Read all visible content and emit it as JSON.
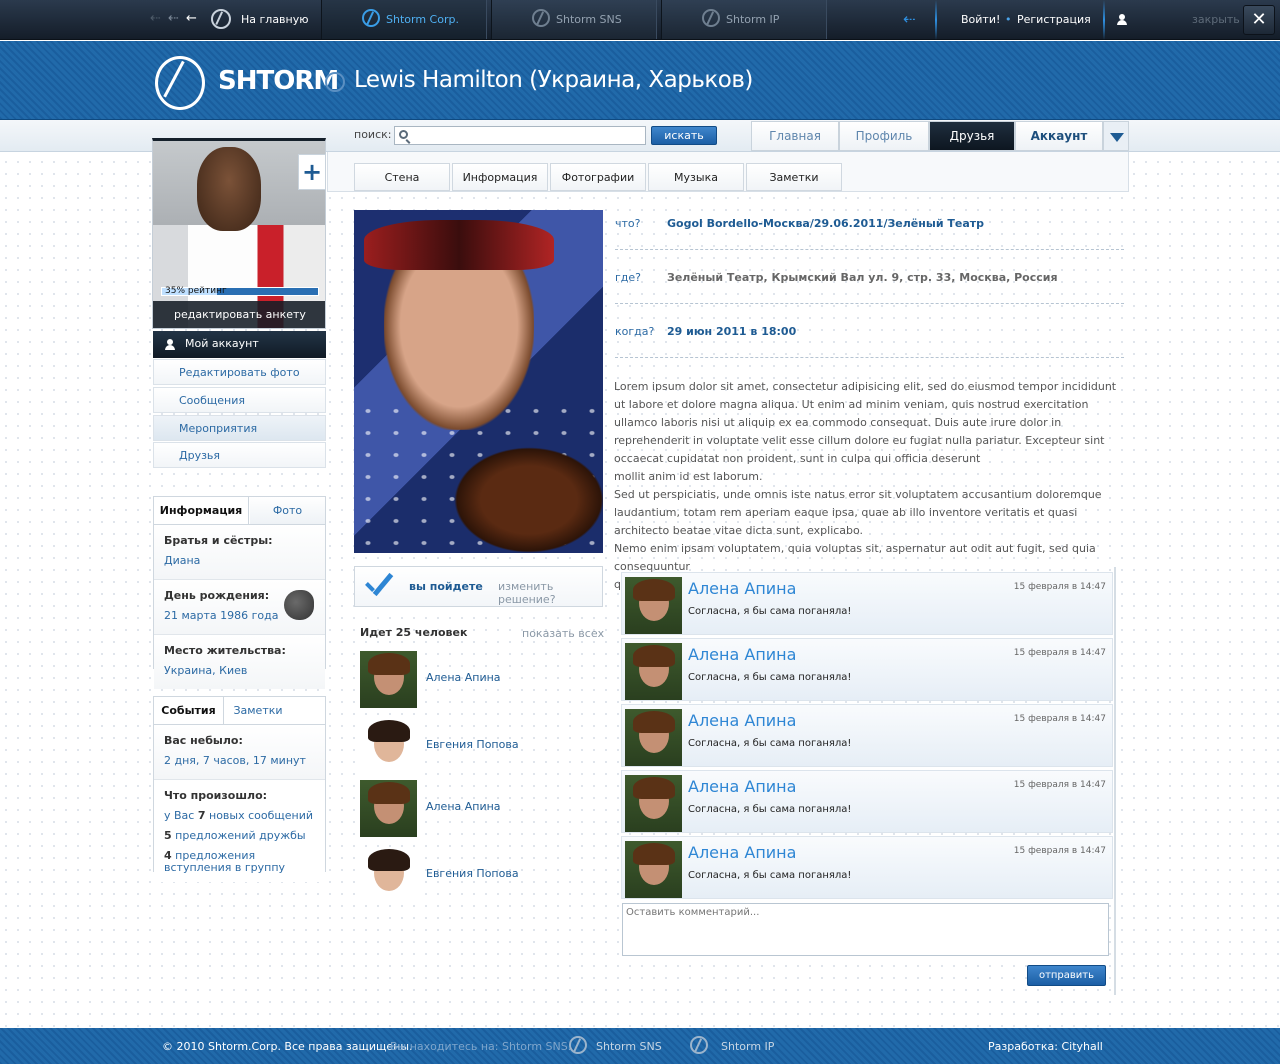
{
  "topbar": {
    "home": "На главную",
    "tabs": [
      "Shtorm Corp.",
      "Shtorm SNS",
      "Shtorm IP"
    ],
    "login": "Войти!",
    "register": "Регистрация",
    "close": "закрыть -"
  },
  "header": {
    "brand": "SHTORM",
    "title": "Lewis Hamilton (Украина, Харьков)"
  },
  "search": {
    "label": "поиск:",
    "placeholder": "",
    "button": "искать"
  },
  "main_tabs": [
    "Главная",
    "Профиль",
    "Друзья",
    "Аккаунт"
  ],
  "sub_tabs": [
    "Стена",
    "Информация",
    "Фотографии",
    "Музыка",
    "Заметки"
  ],
  "profile": {
    "rating": "35% рейтинг",
    "rating_value": 0.35,
    "edit": "редактировать анкету"
  },
  "side_nav": {
    "my_account": "Мой аккаунт",
    "items": [
      "Редактировать фото",
      "Сообщения",
      "Мероприятия",
      "Друзья"
    ]
  },
  "info_box": {
    "tabs": [
      "Информация",
      "Фото"
    ],
    "siblings_label": "Братья и сёстры:",
    "siblings_value": "Диана",
    "birthday_label": "День рождения:",
    "birthday_value": "21 марта 1986 года",
    "residence_label": "Место жительства:",
    "residence_value": "Украина, Киев"
  },
  "events_box": {
    "tabs": [
      "События",
      "Заметки"
    ],
    "absent_label": "Вас небыло:",
    "absent_value": "2 дня, 7 часов, 17 минут",
    "happened_label": "Что произошло:",
    "l1_pre": "у Вас ",
    "l1_num": "7",
    "l1_post": " новых сообщений",
    "l2_num": "5",
    "l2_post": " предложений дружбы",
    "l3_num": "4",
    "l3_post": " предложения вступления в группу"
  },
  "event": {
    "what_label": "что?",
    "what": "Gogol Bordello-Москва/29.06.2011/Зелёный Театр",
    "where_label": "где?",
    "where": "Зелёный Театр, Крымский Вал ул. 9, стр. 33, Москва, Россия",
    "when_label": "когда?",
    "when": "29 июн 2011 в 18:00",
    "description": "Lorem ipsum dolor sit amet, consectetur adipisicing elit, sed do eiusmod tempor incididunt ut labore et dolore magna aliqua. Ut enim ad minim veniam, quis nostrud exercitation ullamco laboris nisi ut aliquip ex ea commodo consequat. Duis aute irure dolor in reprehenderit in voluptate velit esse cillum dolore eu fugiat nulla pariatur. Excepteur sint occaecat cupidatat non proident, sunt in culpa qui officia deserunt\n mollit anim id est laborum.\nSed ut perspiciatis, unde omnis iste natus error sit voluptatem accusantium doloremque laudantium, totam rem aperiam eaque ipsa, quae ab illo inventore veritatis et quasi architecto beatae vitae dicta sunt, explicabo.\nNemo enim ipsam voluptatem, quia voluptas sit, aspernatur aut odit aut fugit, sed quia consequuntur\n qui dolorem ipsum, quia dolor sit, amet, consectetur, adipisci velit, sed quia non"
  },
  "going": {
    "status": "вы пойдете",
    "change": "изменить решение?",
    "title": "Идет 25 человек",
    "show_all": "показать всех",
    "people": [
      "Алена Апина",
      "Евгения Попова",
      "Алена Апина",
      "Евгения Попова"
    ]
  },
  "comments": [
    {
      "name": "Алена Апина",
      "date": "15 февраля в 14:47",
      "text": "Согласна, я бы сама поганяла!"
    },
    {
      "name": "Алена Апина",
      "date": "15 февраля в 14:47",
      "text": "Согласна, я бы сама поганяла!"
    },
    {
      "name": "Алена Апина",
      "date": "15 февраля в 14:47",
      "text": "Согласна, я бы сама поганяла!"
    },
    {
      "name": "Алена Апина",
      "date": "15 февраля в 14:47",
      "text": "Согласна, я бы сама поганяла!"
    },
    {
      "name": "Алена Апина",
      "date": "15 февраля в 14:47",
      "text": "Согласна, я бы сама поганяла!"
    }
  ],
  "comment_form": {
    "placeholder": "Оставить комментарий...",
    "submit": "отправить"
  },
  "footer": {
    "copyright": "© 2010 Shtorm.Corp. Все права защищены.",
    "location": "Вы находитесь на: Shtorm SNS.",
    "link_sns": "Shtorm SNS",
    "link_ip": "Shtorm IP",
    "developer": "Разработка: Cityhall"
  },
  "colors": {
    "accent": "#1e5b93",
    "header_blue": "#1a5e9e",
    "topbar": "#1b2633"
  },
  "icons": [
    "back-arrow-icon",
    "home-arrow-icon",
    "shtorm-logo-icon",
    "login-arrow-icon",
    "user-icon",
    "close-icon",
    "search-icon",
    "dropdown-arrow-icon",
    "plus-icon",
    "checkmark-icon",
    "aries-icon"
  ]
}
